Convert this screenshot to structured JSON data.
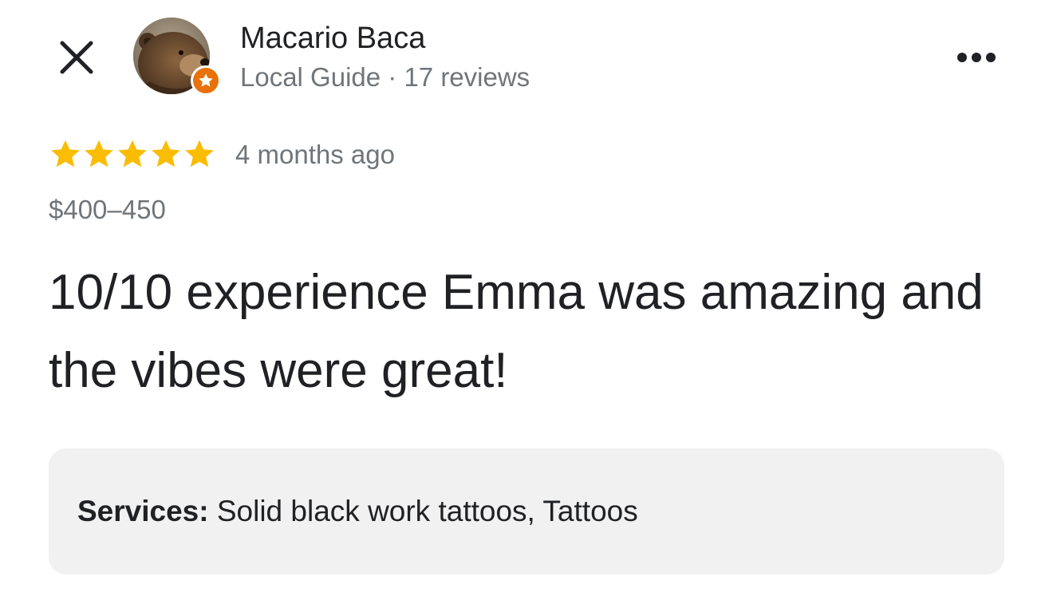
{
  "review": {
    "author": {
      "name": "Macario Baca",
      "meta": "Local Guide · 17 reviews",
      "avatar_icon": "bear-photo-avatar",
      "badge_icon": "local-guide-star-icon",
      "badge_color": "#e8710a"
    },
    "rating": 5,
    "rating_max": 5,
    "star_color": "#fbbc04",
    "date": "4 months ago",
    "price": "$400–450",
    "text": "10/10 experience Emma was amazing and the vibes were great!",
    "services": {
      "label": "Services:",
      "value": " Solid black work tattoos, Tattoos"
    }
  },
  "toolbar": {
    "close_icon": "close-icon",
    "more_icon": "more-options-icon"
  }
}
